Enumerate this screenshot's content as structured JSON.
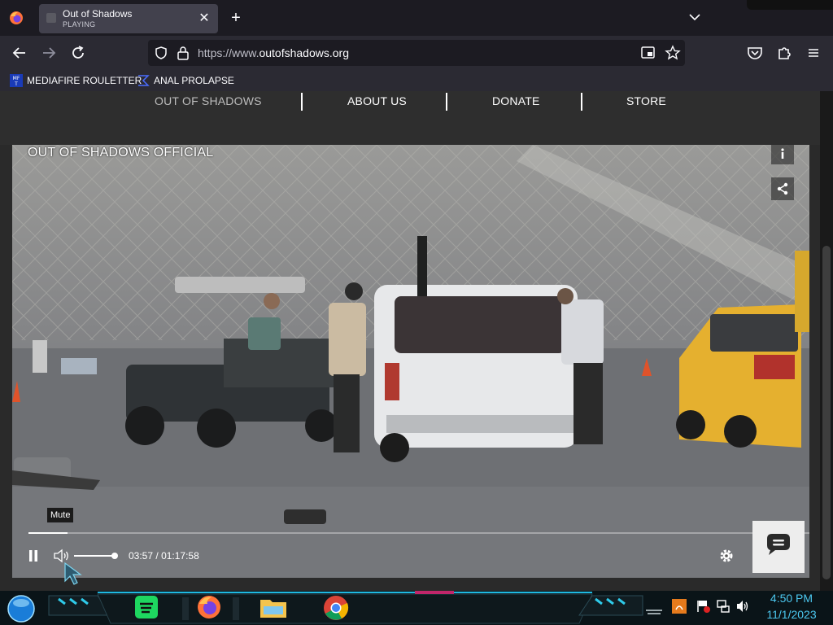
{
  "browser": {
    "tab": {
      "title": "Out of Shadows",
      "status": "PLAYING"
    },
    "url": {
      "prefix": "https://www.",
      "domain": "outofshadows.org"
    },
    "bookmarks": [
      {
        "label": "MEDIAFIRE ROULETTER",
        "icon": "mediafire-icon"
      },
      {
        "label": "ANAL PROLAPSE",
        "icon": "sigma-icon"
      }
    ]
  },
  "site": {
    "nav": [
      "OUT OF SHADOWS",
      "ABOUT US",
      "DONATE",
      "STORE"
    ]
  },
  "video": {
    "channel": "OUT OF SHADOWS OFFICIAL",
    "tooltip": "Mute",
    "current_time": "03:57",
    "separator": "/",
    "duration": "01:17:58",
    "progress": 0.0504,
    "volume": 1.0
  },
  "taskbar": {
    "time": "4:50 PM",
    "date": "11/1/2023"
  },
  "colors": {
    "browser_bg": "#1c1b22",
    "toolbar": "#2b2a33",
    "accent_cyan": "#4cc8f0"
  }
}
